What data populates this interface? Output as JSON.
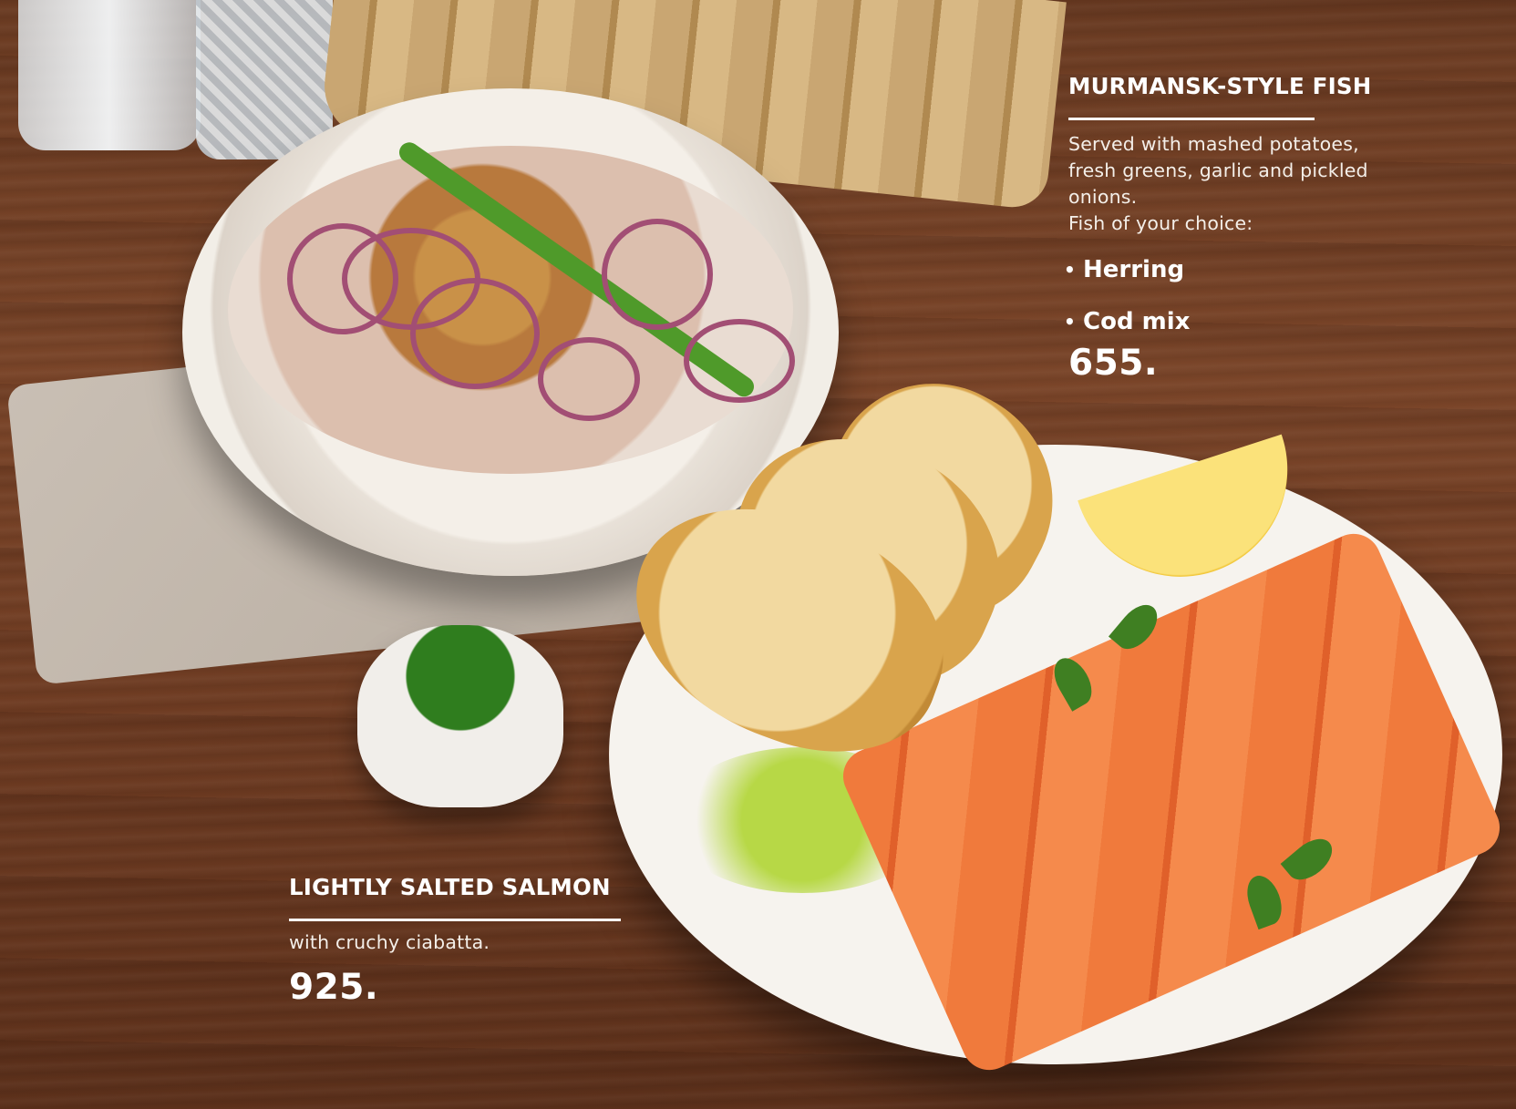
{
  "dishes": [
    {
      "title": "MURMANSK-STYLE FISH",
      "description": "Served with mashed potatoes, fresh greens, garlic and pickled onions.\nFish of your choice:",
      "options": [
        "Herring",
        "Cod mix"
      ],
      "price": "655."
    },
    {
      "title": "LIGHTLY SALTED SALMON",
      "description": "with cruchy ciabatta.",
      "price": "925."
    }
  ],
  "photo_items": [
    "water-glass",
    "bread-basket",
    "linen-napkin",
    "fish-bowl",
    "scallion-ramekin",
    "salmon-plate",
    "ciabatta-toast",
    "lemon-wedge",
    "herb-oil-sauce",
    "basil-leaves"
  ],
  "colors": {
    "text": "#ffffff",
    "table_wood": "#6d3b22",
    "salmon": "#f07a3c"
  }
}
